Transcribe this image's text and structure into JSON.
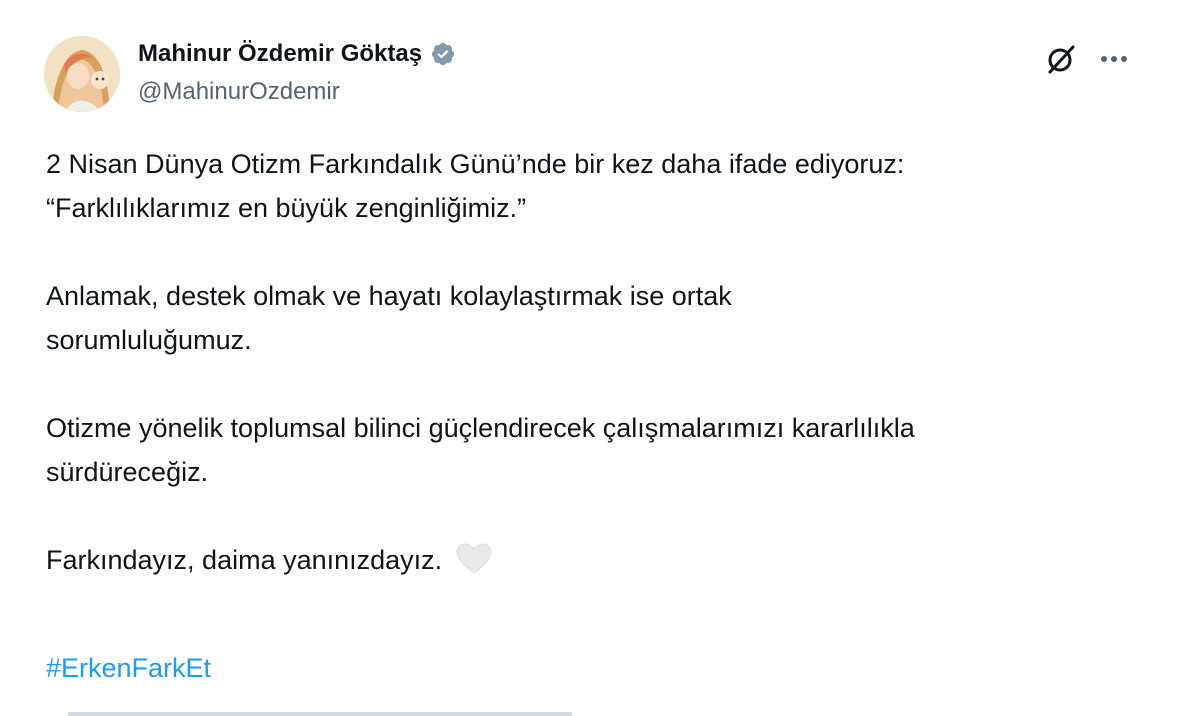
{
  "author": {
    "display_name": "Mahinur Özdemir Göktaş",
    "handle": "@MahinurOzdemir",
    "verified_icon": "verified-badge-icon",
    "verified_color": "#829aab"
  },
  "actions": {
    "grok_icon": "grok-icon",
    "more_icon": "more-options-icon"
  },
  "tweet": {
    "p1_line1": "2 Nisan Dünya Otizm Farkındalık Günü’nde bir kez daha ifade ediyoruz:",
    "p1_line2": "“Farklılıklarımız en büyük zenginliğimiz.”",
    "p2_line1": "Anlamak, destek olmak ve hayatı kolaylaştırmak ise ortak",
    "p2_line2": "sorumluluğumuz.",
    "p3_line1": "Otizme yönelik toplumsal bilinci güçlendirecek çalışmalarımızı kararlılıkla",
    "p3_line2": "sürdüreceğiz.",
    "p4_line1": "Farkındayız, daima yanınızdayız.",
    "heart_icon": "white-heart-icon",
    "hashtag": "#ErkenFarkEt"
  },
  "colors": {
    "text": "#0f1419",
    "secondary": "#536471",
    "link": "#1d9bf0"
  }
}
